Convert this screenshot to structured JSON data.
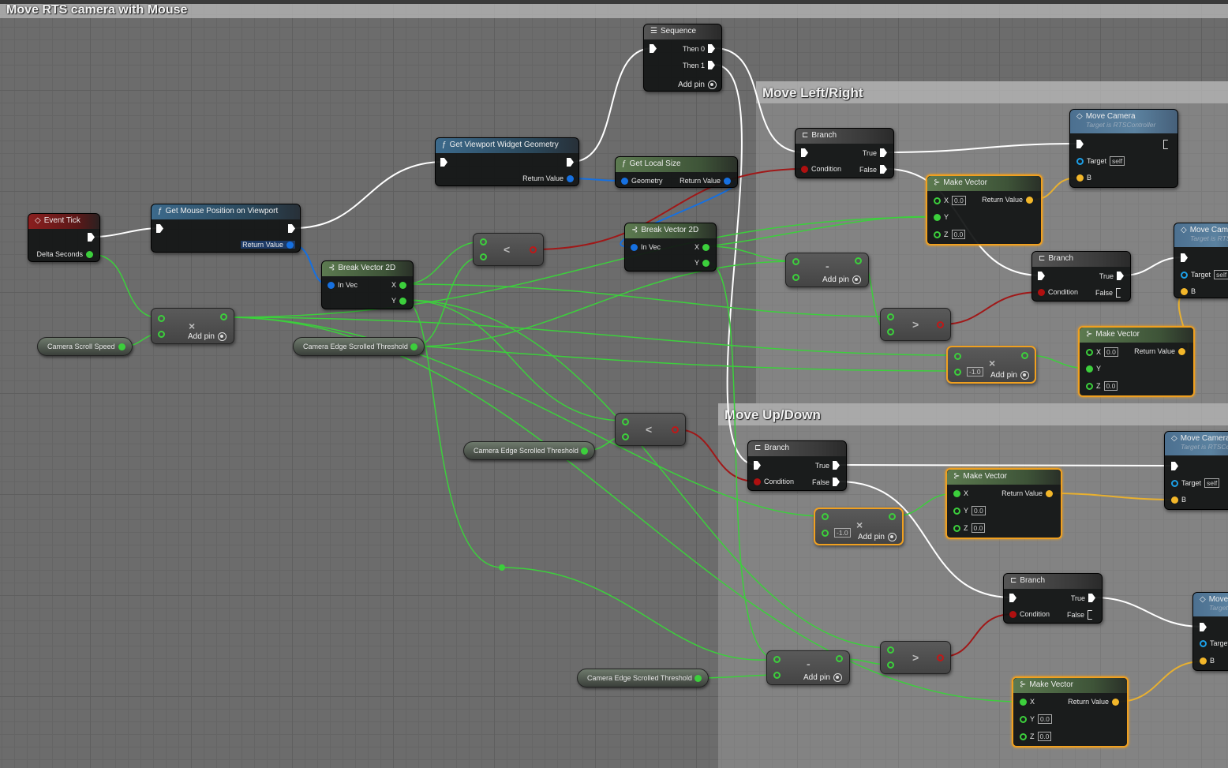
{
  "comments": {
    "main": "Move RTS camera with Mouse",
    "left_right": "Move Left/Right",
    "up_down": "Move Up/Down"
  },
  "event_tick": {
    "title": "Event Tick",
    "delta": "Delta Seconds"
  },
  "get_mouse": {
    "title": "Get Mouse Position on Viewport",
    "ret": "Return Value"
  },
  "get_viewport": {
    "title": "Get Viewport Widget Geometry",
    "ret": "Return Value"
  },
  "get_local": {
    "title": "Get Local Size",
    "geometry": "Geometry",
    "ret": "Return Value"
  },
  "sequence": {
    "title": "Sequence",
    "then0": "Then 0",
    "then1": "Then 1",
    "add": "Add pin"
  },
  "break2d": {
    "title": "Break Vector 2D",
    "invec": "In Vec",
    "x": "X",
    "y": "Y"
  },
  "variables": {
    "scroll_speed": "Camera Scroll Speed",
    "threshold": "Camera Edge Scrolled Threshold"
  },
  "ops": {
    "mul": "×",
    "sub": "-",
    "lt": "<",
    "gt": ">",
    "add_pin": "Add pin",
    "neg": "-1.0"
  },
  "branch": {
    "title": "Branch",
    "true": "True",
    "false": "False",
    "condition": "Condition"
  },
  "move_camera": {
    "title": "Move Camera",
    "subtitle": "Target is RTSController",
    "target": "Target",
    "self": "self",
    "b": "B"
  },
  "make_vector": {
    "title": "Make Vector",
    "x": "X",
    "y": "Y",
    "z": "Z",
    "ret": "Return Value",
    "default": "0.0"
  }
}
